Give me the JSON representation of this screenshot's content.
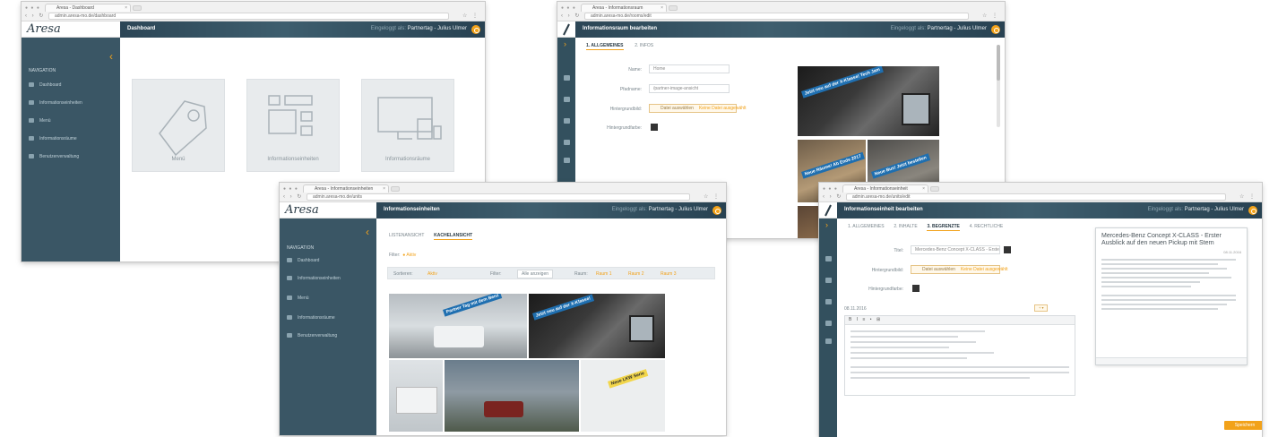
{
  "shots": {
    "dashboard": {
      "tab_title": "Aresa - Dashboard",
      "url": "admin.aresa-mo.de/dashboard",
      "logo": "Aresa",
      "page_title": "Dashboard",
      "user_prefix": "Eingeloggt als:",
      "user_name": "Partnertag - Julius Ulmer",
      "nav_head": "NAVIGATION",
      "nav": [
        "Dashboard",
        "Informationseinheiten",
        "Menü",
        "Informationsräume",
        "Benutzerverwaltung"
      ],
      "tiles": [
        "Menü",
        "Informationseinheiten",
        "Informationsräume"
      ]
    },
    "room_edit": {
      "tab_title": "Aresa - Informationsraum",
      "url": "admin.aresa-mo.de/rooms/edit",
      "page_title": "Informationsraum bearbeiten",
      "user_prefix": "Eingeloggt als:",
      "user_name": "Partnertag - Julius Ulmer",
      "tabs": [
        "1. ALLGEMEINES",
        "2. INFOS"
      ],
      "fields": [
        {
          "label": "Name:",
          "value": "Home"
        },
        {
          "label": "Pfadname:",
          "value": "/partner-image-ansicht"
        },
        {
          "label": "Hintergrundbild:",
          "value": "Datei auswählen"
        },
        {
          "label": "Hintergrundfarbe:",
          "value": ""
        }
      ],
      "upload_hint": "Keine Datei ausgewählt",
      "images": [
        "Jetzt neu auf der X-Klasse! Tech Jam",
        "Neue Räume! Ab Ende 2017",
        "Neue Bus! Jetzt bestellen"
      ]
    },
    "units": {
      "tab_title": "Aresa - Informationseinheiten",
      "url": "admin.aresa-mo.de/units",
      "logo": "Aresa",
      "page_title": "Informationseinheiten",
      "user_prefix": "Eingeloggt als:",
      "user_name": "Partnertag - Julius Ulmer",
      "nav_head": "NAVIGATION",
      "nav": [
        "Dashboard",
        "Informationseinheiten",
        "Menü",
        "Informationsräume",
        "Benutzerverwaltung"
      ],
      "view_tabs": [
        "LISTENANSICHT",
        "KACHELANSICHT"
      ],
      "filter_label": "Filter:",
      "filter_chip": "Aktiv",
      "filter_items": [
        "Sortieren:",
        "Aktiv",
        "Filter:",
        "Alle anzeigen",
        "Raum:",
        "Raum 1",
        "Raum 2",
        "Raum 3"
      ],
      "images": [
        "Partner Tag mit dem Benz",
        "Jetzt neu auf der X-Klasse!",
        "",
        "",
        "Neue LKW Serie"
      ]
    },
    "unit_edit": {
      "tab_title": "Aresa - Informationseinheit",
      "url": "admin.aresa-mo.de/units/edit",
      "page_title": "Informationseinheit bearbeiten",
      "user_prefix": "Eingeloggt als:",
      "user_name": "Partnertag - Julius Ulmer",
      "tabs": [
        "1. ALLGEMEINES",
        "2. INHALTE",
        "3. BEGRENZTE",
        "4. RECHTLICHE"
      ],
      "title_label": "Titel:",
      "title_value": "Mercedes-Benz Concept X-CLASS - Erster Ausblick",
      "bg_image_label": "Hintergrundbild:",
      "bg_color_label": "Hintergrundfarbe:",
      "upload_btn": "Datei auswählen",
      "upload_hint": "Keine Datei ausgewählt",
      "date": "08.11.2016",
      "toolbar": "B  I  ≡  •  ⊞",
      "preview_title": "Mercedes-Benz Concept X-CLASS - Erster Ausblick auf den neuen Pickup mit Stern",
      "preview_date": "08.11.2016",
      "save": "Speichern"
    }
  }
}
